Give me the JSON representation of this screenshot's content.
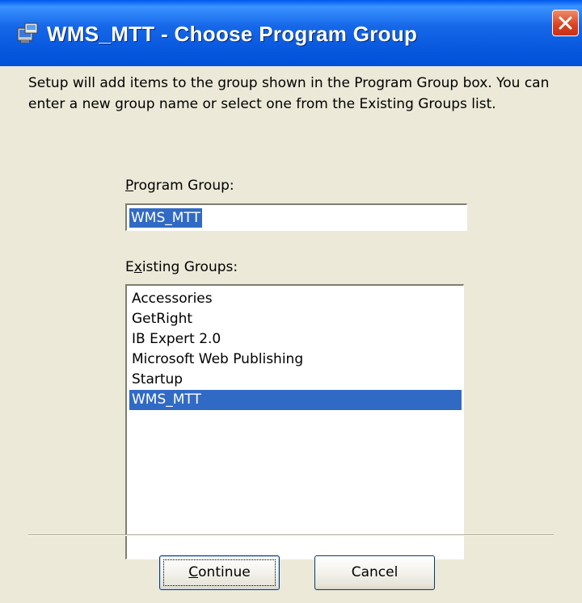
{
  "window": {
    "title": "WMS_MTT - Choose Program Group",
    "icon": "setup-installer-icon",
    "close_icon": "close-icon"
  },
  "intro_text": "Setup will add items to the group shown in the Program Group box. You can enter a new group name or select one from the Existing Groups list.",
  "program_group": {
    "label_mnemonic": "P",
    "label_rest": "rogram Group:",
    "value": "WMS_MTT"
  },
  "existing_groups": {
    "label_first": "E",
    "label_mnemonic": "x",
    "label_rest": "isting Groups:",
    "items": [
      {
        "label": "Accessories"
      },
      {
        "label": "GetRight"
      },
      {
        "label": "IB Expert 2.0"
      },
      {
        "label": "Microsoft Web Publishing"
      },
      {
        "label": "Startup"
      },
      {
        "label": "WMS_MTT"
      }
    ],
    "selected_index": 5
  },
  "buttons": {
    "continue_mnemonic": "C",
    "continue_rest": "ontinue",
    "cancel_label": "Cancel"
  },
  "colors": {
    "titlebar": "#0a5ae0",
    "selection": "#316ac5",
    "dialog_bg": "#ece9d8",
    "close_button": "#d9401e"
  }
}
